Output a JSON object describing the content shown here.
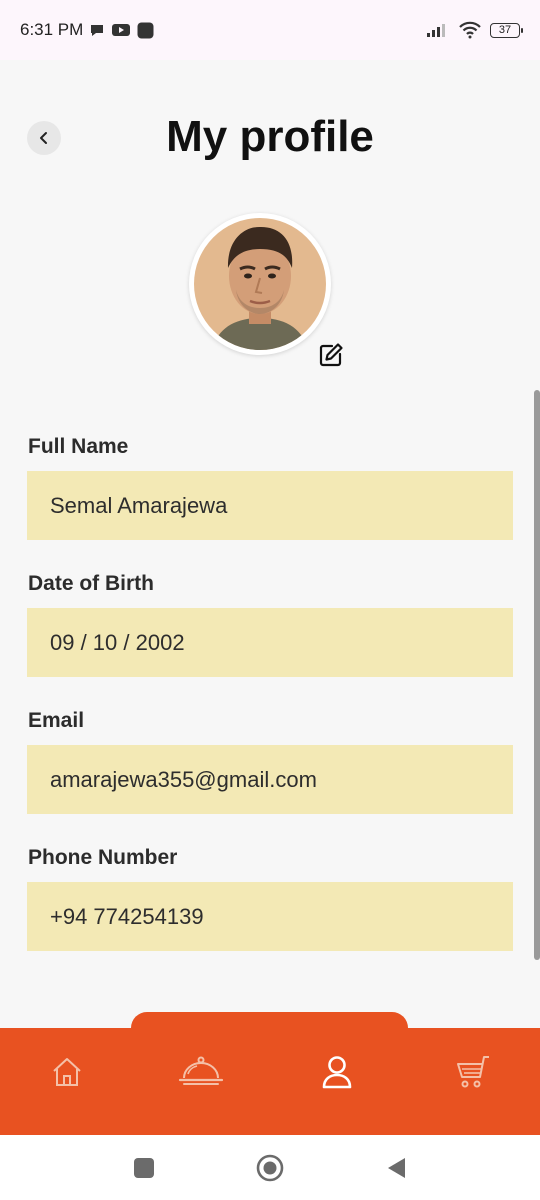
{
  "status_bar": {
    "time": "6:31 PM",
    "battery": "37"
  },
  "header": {
    "title": "My profile"
  },
  "fields": [
    {
      "label": "Full Name",
      "value": "Semal Amarajewa"
    },
    {
      "label": "Date of Birth",
      "value": "09 / 10 / 2002"
    },
    {
      "label": "Email",
      "value": "amarajewa355@gmail.com"
    },
    {
      "label": "Phone Number",
      "value": "+94 774254139"
    }
  ],
  "bottom_nav": {
    "items": [
      "home-icon",
      "food-cloche-icon",
      "profile-icon",
      "cart-icon"
    ],
    "active": "profile-icon"
  },
  "colors": {
    "accent": "#e85221",
    "field_bg": "#f3e9b5",
    "page_bg": "#f7f7f7"
  }
}
